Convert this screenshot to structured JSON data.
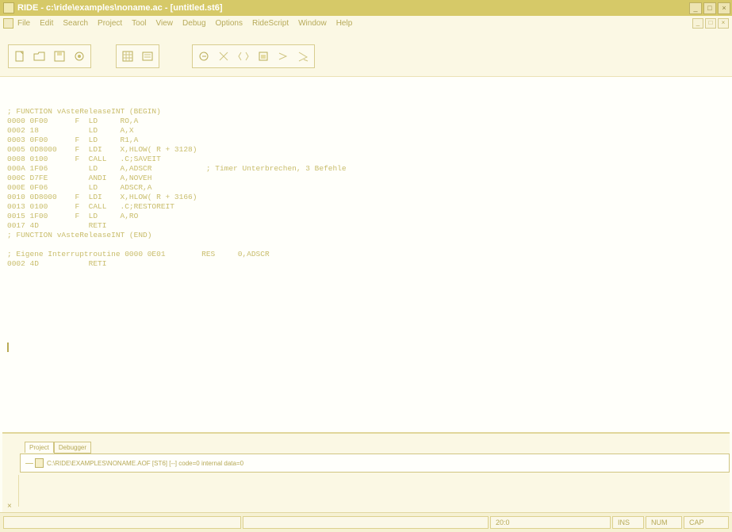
{
  "window": {
    "title": "RIDE - c:\\ride\\examples\\noname.ac - [untitled.st6]",
    "controls": [
      "_",
      "□",
      "×"
    ]
  },
  "menu": [
    "File",
    "Edit",
    "Search",
    "Project",
    "Tool",
    "View",
    "Debug",
    "Options",
    "RideScript",
    "Window",
    "Help"
  ],
  "doc_controls": [
    "_",
    "□",
    "×"
  ],
  "toolbar": {
    "groups": [
      [
        "new-file-icon",
        "open-file-icon",
        "save-file-icon",
        "watch-icon"
      ],
      [
        "grid-icon",
        "memory-icon"
      ],
      [
        "step-icon",
        "cut-icon",
        "copy-icon",
        "paste-icon",
        "run-icon",
        "go-icon"
      ]
    ]
  },
  "code": [
    "; FUNCTION vAsteReleaseINT (BEGIN)",
    "0000 0F00      F  LD     RO,A",
    "0002 18           LD     A,X",
    "0003 0F00      F  LD     R1,A",
    "0005 0D8000    F  LDI    X,HLOW( R + 3128)",
    "0008 0100      F  CALL   .C;SAVEIT",
    "000A 1F06         LD     A,ADSCR            ; Timer Unterbrechen, 3 Befehle",
    "000C D7FE         ANDI   A,NOVEH",
    "000E 0F06         LD     ADSCR,A",
    "0010 0D8000    F  LDI    X,HLOW( R + 3166)",
    "0013 0100      F  CALL   .C;RESTOREIT",
    "0015 1F00      F  LD     A,RO",
    "0017 4D           RETI",
    "; FUNCTION vAsteReleaseINT (END)",
    "",
    "; Eigene Interruptroutine 0000 0E01        RES     0,ADSCR",
    "0002 4D           RETI"
  ],
  "panel": {
    "tabs": [
      "Project",
      "Debugger"
    ],
    "project_item": "C:\\RIDE\\EXAMPLES\\NONAME.AOF [ST6] [--] code=0 internal data=0",
    "close": "×"
  },
  "status": {
    "position": "20:0",
    "ins": "INS",
    "mode": "NUM",
    "extra": "CAP"
  }
}
